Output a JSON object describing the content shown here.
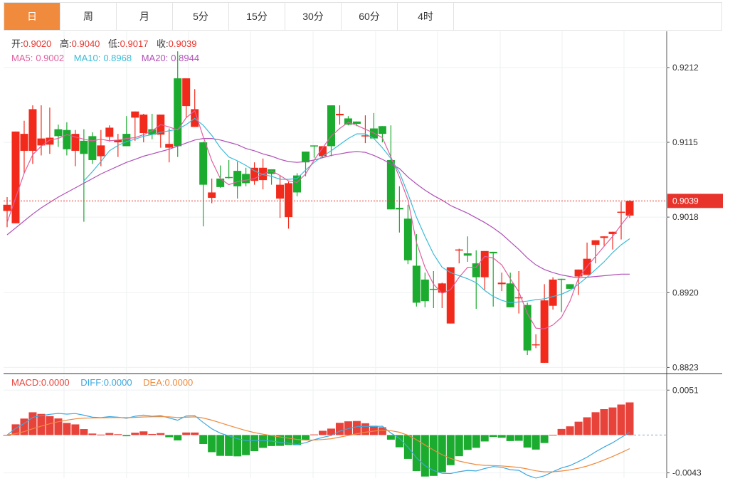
{
  "tabs": [
    "日",
    "周",
    "月",
    "5分",
    "15分",
    "30分",
    "60分",
    "4时"
  ],
  "active_tab": 0,
  "colors": {
    "up": "#f22a1c",
    "down": "#1aab2f",
    "ma5": "#e05fa0",
    "ma10": "#3bbcd8",
    "ma20": "#b050b8",
    "macd": "#e8433b",
    "diff": "#3ba8e0",
    "dea": "#f08a3c",
    "tab_active": "#f08a3c",
    "last_price": "#e8332c"
  },
  "ohlc_info": {
    "open_label": "开:",
    "open": "0.9020",
    "high_label": "高:",
    "high": "0.9040",
    "low_label": "低:",
    "low": "0.9017",
    "close_label": "收:",
    "close": "0.9039"
  },
  "ma_info": {
    "ma5_label": "MA5:",
    "ma5": "0.9002",
    "ma10_label": "MA10:",
    "ma10": "0.8968",
    "ma20_label": "MA20:",
    "ma20": "0.8944"
  },
  "macd_info": {
    "macd_label": "MACD:",
    "macd": "0.0000",
    "diff_label": "DIFF:",
    "diff": "0.0000",
    "dea_label": "DEA:",
    "dea": "0.0000"
  },
  "chart_data": {
    "type": "candlestick",
    "price_ticks": [
      "0.9212",
      "0.9115",
      "0.9018",
      "0.8920",
      "0.8823"
    ],
    "price_ylim": [
      0.8816,
      0.9259
    ],
    "last_price": "0.9039",
    "macd_ticks": [
      "0.0051",
      "-0.0043"
    ],
    "macd_ylim": [
      -0.0049,
      0.0069
    ],
    "candles": [
      [
        0.9026,
        0.9044,
        0.9005,
        0.9034
      ],
      [
        0.901,
        0.9044,
        0.901,
        0.9129
      ],
      [
        0.9104,
        0.9143,
        0.9075,
        0.9126
      ],
      [
        0.9104,
        0.9163,
        0.9087,
        0.9158
      ],
      [
        0.9111,
        0.9163,
        0.9098,
        0.912
      ],
      [
        0.9112,
        0.916,
        0.91,
        0.9121
      ],
      [
        0.9132,
        0.9138,
        0.9109,
        0.9123
      ],
      [
        0.9131,
        0.9141,
        0.9098,
        0.9106
      ],
      [
        0.9104,
        0.9131,
        0.9084,
        0.9126
      ],
      [
        0.9117,
        0.9132,
        0.9012,
        0.91
      ],
      [
        0.9123,
        0.9128,
        0.9087,
        0.9092
      ],
      [
        0.9097,
        0.9131,
        0.9084,
        0.9111
      ],
      [
        0.9122,
        0.9137,
        0.9116,
        0.9134
      ],
      [
        0.9115,
        0.9126,
        0.9096,
        0.9118
      ],
      [
        0.9126,
        0.9149,
        0.9112,
        0.911
      ],
      [
        0.9147,
        0.9149,
        0.9117,
        0.9155
      ],
      [
        0.9127,
        0.9152,
        0.9115,
        0.9151
      ],
      [
        0.9132,
        0.9152,
        0.9119,
        0.9125
      ],
      [
        0.9125,
        0.9151,
        0.9108,
        0.9151
      ],
      [
        0.9108,
        0.9133,
        0.9089,
        0.9113
      ],
      [
        0.9198,
        0.9233,
        0.9096,
        0.911
      ],
      [
        0.9162,
        0.9189,
        0.9147,
        0.9198
      ],
      [
        0.9135,
        0.9184,
        0.9142,
        0.9158
      ],
      [
        0.9115,
        0.9116,
        0.9006,
        0.906
      ],
      [
        0.9043,
        0.9068,
        0.9036,
        0.905
      ],
      [
        0.9068,
        0.9085,
        0.9056,
        0.9057
      ],
      [
        0.907,
        0.9092,
        0.9068,
        0.9069
      ],
      [
        0.9078,
        0.909,
        0.9042,
        0.9058
      ],
      [
        0.9074,
        0.9082,
        0.9058,
        0.9062
      ],
      [
        0.9065,
        0.9089,
        0.906,
        0.9082
      ],
      [
        0.9066,
        0.9094,
        0.9054,
        0.9082
      ],
      [
        0.908,
        0.9072,
        0.906,
        0.9074
      ],
      [
        0.9042,
        0.9072,
        0.9017,
        0.906
      ],
      [
        0.9018,
        0.9064,
        0.9003,
        0.9062
      ],
      [
        0.9072,
        0.9075,
        0.9045,
        0.905
      ],
      [
        0.9103,
        0.9089,
        0.9071,
        0.9089
      ],
      [
        0.9111,
        0.9102,
        0.9095,
        0.911
      ],
      [
        0.9097,
        0.9103,
        0.9095,
        0.911
      ],
      [
        0.9163,
        0.9163,
        0.9097,
        0.911
      ],
      [
        0.915,
        0.9163,
        0.9138,
        0.9152
      ],
      [
        0.9146,
        0.9149,
        0.9137,
        0.9138
      ],
      [
        0.9142,
        0.9134,
        0.9136,
        0.9139
      ],
      [
        0.9124,
        0.915,
        0.9114,
        0.9124
      ],
      [
        0.9133,
        0.9153,
        0.9121,
        0.912
      ],
      [
        0.9136,
        0.9131,
        0.9115,
        0.9126
      ],
      [
        0.9092,
        0.9137,
        0.9093,
        0.9028
      ],
      [
        0.903,
        0.9058,
        0.8998,
        0.9028
      ],
      [
        0.9016,
        0.9034,
        0.8957,
        0.8962
      ],
      [
        0.8955,
        0.8996,
        0.8902,
        0.8907
      ],
      [
        0.8937,
        0.8946,
        0.8901,
        0.8909
      ],
      [
        0.8925,
        0.8948,
        0.89,
        0.8924
      ],
      [
        0.892,
        0.8933,
        0.89,
        0.8932
      ],
      [
        0.888,
        0.8951,
        0.888,
        0.8953
      ],
      [
        0.8976,
        0.8977,
        0.8958,
        0.8976
      ],
      [
        0.8971,
        0.8993,
        0.896,
        0.8968
      ],
      [
        0.8958,
        0.8975,
        0.8899,
        0.894
      ],
      [
        0.894,
        0.8972,
        0.8924,
        0.8974
      ],
      [
        0.8973,
        0.8969,
        0.8902,
        0.8971
      ],
      [
        0.8931,
        0.8946,
        0.8922,
        0.8933
      ],
      [
        0.8932,
        0.8946,
        0.8904,
        0.8901
      ],
      [
        0.8914,
        0.8948,
        0.8893,
        0.8914
      ],
      [
        0.8904,
        0.8907,
        0.8839,
        0.8845
      ],
      [
        0.8853,
        0.8866,
        0.8848,
        0.8853
      ],
      [
        0.8829,
        0.8931,
        0.883,
        0.891
      ],
      [
        0.8903,
        0.894,
        0.8898,
        0.8937
      ],
      [
        0.8938,
        0.8906,
        0.8895,
        0.8937
      ],
      [
        0.8931,
        0.893,
        0.8925,
        0.8925
      ],
      [
        0.8941,
        0.8928,
        0.8917,
        0.895
      ],
      [
        0.8943,
        0.8985,
        0.8945,
        0.8964
      ],
      [
        0.8982,
        0.8982,
        0.8958,
        0.8988
      ],
      [
        0.8991,
        0.8986,
        0.8981,
        0.8993
      ],
      [
        0.8996,
        0.8999,
        0.8976,
        0.8999
      ],
      [
        0.9025,
        0.9038,
        0.8989,
        0.9025
      ],
      [
        0.902,
        0.904,
        0.9017,
        0.9039
      ]
    ],
    "ma5": [
      0.9011,
      0.9043,
      0.9075,
      0.9099,
      0.911,
      0.9118,
      0.912,
      0.9125,
      0.9122,
      0.9119,
      0.9117,
      0.9119,
      0.9117,
      0.9118,
      0.912,
      0.9121,
      0.9125,
      0.913,
      0.9138,
      0.9135,
      0.9131,
      0.9147,
      0.9156,
      0.9122,
      0.9091,
      0.9068,
      0.906,
      0.9064,
      0.9066,
      0.9068,
      0.9074,
      0.9078,
      0.9072,
      0.9065,
      0.9063,
      0.9074,
      0.9092,
      0.9108,
      0.9123,
      0.9133,
      0.9141,
      0.9137,
      0.9132,
      0.9127,
      0.9121,
      0.9096,
      0.907,
      0.904,
      0.8985,
      0.8953,
      0.8931,
      0.8919,
      0.8924,
      0.894,
      0.8953,
      0.8953,
      0.8967,
      0.8965,
      0.8956,
      0.8938,
      0.8921,
      0.8893,
      0.8874,
      0.8873,
      0.8878,
      0.8888,
      0.8909,
      0.8939,
      0.8954,
      0.8967,
      0.898,
      0.8993,
      0.9008,
      0.9022
    ],
    "ma10": [
      null,
      null,
      null,
      null,
      null,
      null,
      null,
      null,
      null,
      0.9065,
      0.9077,
      0.909,
      0.9104,
      0.9111,
      0.9116,
      0.9119,
      0.9123,
      0.9125,
      0.9128,
      0.913,
      0.9132,
      0.9138,
      0.9146,
      0.9137,
      0.9124,
      0.9108,
      0.9096,
      0.9091,
      0.9085,
      0.9078,
      0.9073,
      0.9071,
      0.9067,
      0.9067,
      0.9068,
      0.9079,
      0.9089,
      0.9097,
      0.9104,
      0.9112,
      0.912,
      0.9126,
      0.9126,
      0.912,
      0.9108,
      0.9094,
      0.9076,
      0.9048,
      0.9018,
      0.8993,
      0.897,
      0.8953,
      0.8946,
      0.8942,
      0.8938,
      0.8933,
      0.8923,
      0.8915,
      0.891,
      0.8907,
      0.8908,
      0.8909,
      0.8911,
      0.8912,
      0.8915,
      0.8918,
      0.8923,
      0.8931,
      0.894,
      0.895,
      0.896,
      0.8972,
      0.8982,
      0.899
    ],
    "ma20": [
      0.8995,
      0.9004,
      0.9013,
      0.9022,
      0.903,
      0.9037,
      0.9044,
      0.905,
      0.9056,
      0.9062,
      0.9068,
      0.9074,
      0.9079,
      0.9084,
      0.9089,
      0.9093,
      0.9097,
      0.91,
      0.9103,
      0.9106,
      0.911,
      0.9114,
      0.9118,
      0.912,
      0.912,
      0.9118,
      0.9115,
      0.9112,
      0.9107,
      0.9104,
      0.91,
      0.9097,
      0.9093,
      0.909,
      0.9089,
      0.909,
      0.9092,
      0.9095,
      0.9098,
      0.91,
      0.9102,
      0.9103,
      0.9102,
      0.9098,
      0.9093,
      0.9087,
      0.9081,
      0.907,
      0.9061,
      0.9053,
      0.9046,
      0.904,
      0.9033,
      0.9028,
      0.9023,
      0.9017,
      0.9011,
      0.9004,
      0.8996,
      0.8986,
      0.8976,
      0.8965,
      0.8956,
      0.895,
      0.8946,
      0.8943,
      0.8941,
      0.8939,
      0.894,
      0.8941,
      0.8942,
      0.8943,
      0.8944,
      0.8944
    ]
  }
}
